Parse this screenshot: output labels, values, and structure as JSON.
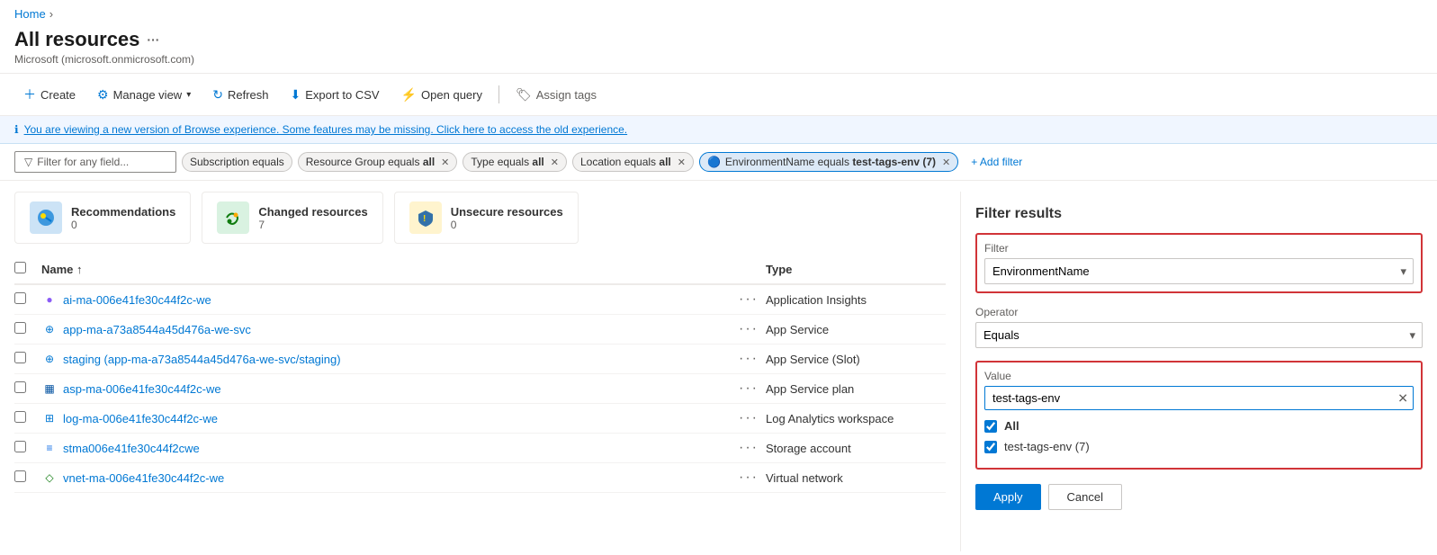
{
  "breadcrumb": {
    "home": "Home"
  },
  "page": {
    "title": "All resources",
    "subtitle": "Microsoft (microsoft.onmicrosoft.com)",
    "more_icon": "···"
  },
  "toolbar": {
    "create": "Create",
    "manage_view": "Manage view",
    "refresh": "Refresh",
    "export_csv": "Export to CSV",
    "open_query": "Open query",
    "assign_tags": "Assign tags"
  },
  "info_banner": {
    "text": "You are viewing a new version of Browse experience. Some features may be missing. Click here to access the old experience."
  },
  "filters": {
    "placeholder": "Filter for any field...",
    "subscription": "Subscription equals",
    "resource_group": "Resource Group equals all",
    "type": "Type equals all",
    "location": "Location equals all",
    "env_name": "EnvironmentName equals test-tags-env (7)",
    "add_filter": "+ Add filter"
  },
  "summary_cards": [
    {
      "label": "Recommendations",
      "count": "0",
      "icon_color": "blue"
    },
    {
      "label": "Changed resources",
      "count": "7",
      "icon_color": "green"
    },
    {
      "label": "Unsecure resources",
      "count": "0",
      "icon_color": "yellow"
    }
  ],
  "table": {
    "col_name": "Name ↑",
    "col_type": "Type",
    "rows": [
      {
        "name": "ai-ma-006e41fe30c44f2c-we",
        "type": "Application Insights",
        "icon_color": "#8B5CF6",
        "icon_char": "●"
      },
      {
        "name": "app-ma-a73a8544a45d476a-we-svc",
        "type": "App Service",
        "icon_color": "#0078d4",
        "icon_char": "⊕"
      },
      {
        "name": "staging (app-ma-a73a8544a45d476a-we-svc/staging)",
        "type": "App Service (Slot)",
        "icon_color": "#0078d4",
        "icon_char": "⊕"
      },
      {
        "name": "asp-ma-006e41fe30c44f2c-we",
        "type": "App Service plan",
        "icon_color": "#0050a0",
        "icon_char": "▦"
      },
      {
        "name": "log-ma-006e41fe30c44f2c-we",
        "type": "Log Analytics workspace",
        "icon_color": "#0078d4",
        "icon_char": "⊞"
      },
      {
        "name": "stma006e41fe30c44f2cwe",
        "type": "Storage account",
        "icon_color": "#1a73e8",
        "icon_char": "≡"
      },
      {
        "name": "vnet-ma-006e41fe30c44f2c-we",
        "type": "Virtual network",
        "icon_color": "#107c10",
        "icon_char": "◇"
      }
    ]
  },
  "filter_panel": {
    "title": "Filter results",
    "filter_label": "Filter",
    "filter_value": "EnvironmentName",
    "operator_label": "Operator",
    "operator_value": "Equals",
    "value_label": "Value",
    "value_input": "test-tags-env",
    "checkboxes": [
      {
        "label": "All",
        "checked": true,
        "bold": true
      },
      {
        "label": "test-tags-env (7)",
        "checked": true,
        "bold": false
      }
    ],
    "apply_btn": "Apply",
    "cancel_btn": "Cancel"
  }
}
